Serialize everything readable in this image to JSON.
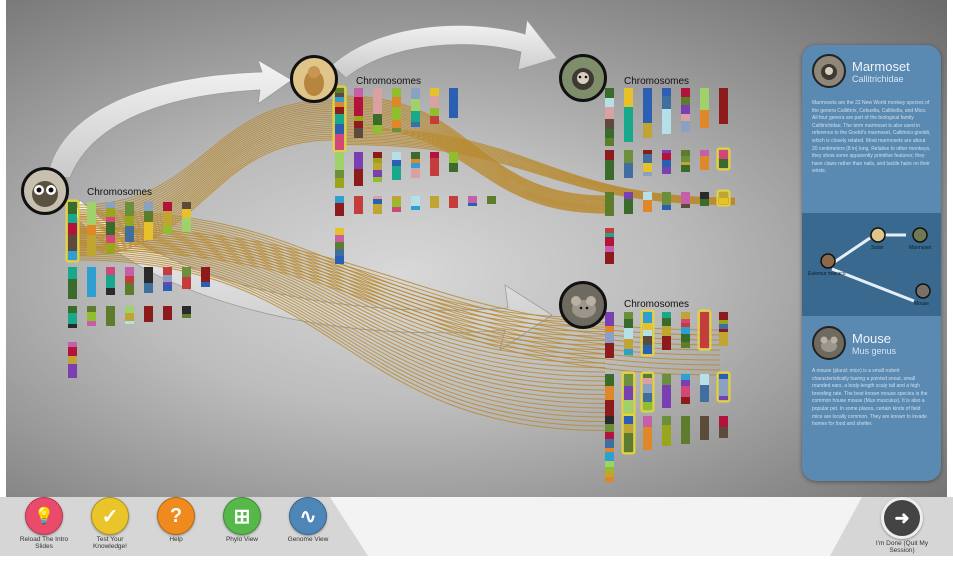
{
  "colors": {
    "syntenyLink": "#b98a2e",
    "panelBlue": "#5a89b2",
    "panelDark": "#39698f",
    "highlight": "#e6d431"
  },
  "genomes": {
    "galago": {
      "title": "Chromosomes",
      "icon": "lemur-icon"
    },
    "tree_shrew": {
      "title": "Chromosomes",
      "icon": "tree-shrew-icon"
    },
    "marmoset": {
      "title": "Chromosomes",
      "icon": "marmoset-icon"
    },
    "mouse": {
      "title": "Chromosomes",
      "icon": "mouse-icon"
    }
  },
  "info_panel": {
    "marmoset": {
      "name": "Marmoset",
      "latin": "Callitrichidae",
      "description": "Marmosets are the 22 New World monkey species of the genera Callithrix, Cebuella, Callibella, and Mico. All four genera are part of the biological family Callitrichidae. The term marmoset is also used in reference to the Goeldi's marmoset, Callimico goeldii, which is closely related. Most marmosets are about 20 centimeters (8 in) long. Relative to other monkeys, they show some apparently primitive features; they have claws rather than nails, and tactile hairs on their wrists."
    },
    "tree": {
      "root": "Eulemur macaco",
      "node1": "Sister",
      "node2": "Marmoset",
      "node3": "Mouse"
    },
    "mouse": {
      "name": "Mouse",
      "latin": "Mus genus",
      "description": "A mouse (plural: mice) is a small rodent characteristically having a pointed snout, small rounded ears, a body-length scaly tail and a high breeding rate. The best known mouse species is the common house mouse (Mus musculus). It is also a popular pet. In some places, certain kinds of field mice are locally common. They are known to invade homes for food and shelter."
    }
  },
  "toolbar": {
    "buttons": [
      {
        "label": "Reload The Intro Slides",
        "color": "#ea4b6b",
        "glyph": "💡",
        "icon": "lightbulb-icon"
      },
      {
        "label": "Test Your Knowledge!",
        "color": "#e9c52a",
        "glyph": "✓",
        "icon": "checklist-icon"
      },
      {
        "label": "Help",
        "color": "#ef8a1f",
        "glyph": "?",
        "icon": "question-icon"
      },
      {
        "label": "Phylo View",
        "color": "#57b84a",
        "glyph": "⊞",
        "icon": "phylo-tree-icon"
      },
      {
        "label": "Genome View",
        "color": "#4e86b8",
        "glyph": "∿",
        "icon": "dna-icon"
      }
    ],
    "done": {
      "label": "I'm Done (Quit My Session)",
      "glyph": "➜",
      "icon": "arrow-right-icon"
    }
  }
}
